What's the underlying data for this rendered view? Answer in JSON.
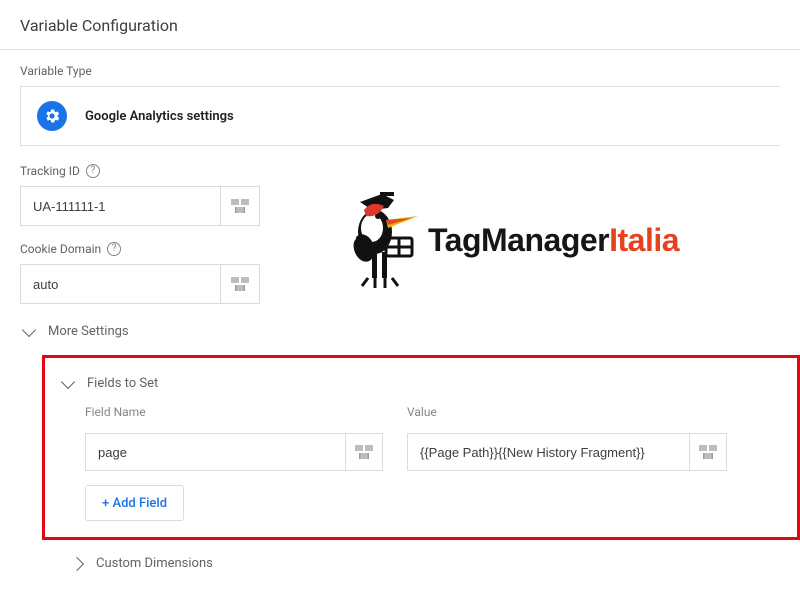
{
  "header": {
    "title": "Variable Configuration"
  },
  "variable_type": {
    "label": "Variable Type",
    "selected": "Google Analytics settings"
  },
  "tracking_id": {
    "label": "Tracking ID",
    "value": "UA-111111-1"
  },
  "cookie_domain": {
    "label": "Cookie Domain",
    "value": "auto"
  },
  "more_settings": {
    "label": "More Settings",
    "fields_to_set": {
      "label": "Fields to Set",
      "columns": {
        "name": "Field Name",
        "value": "Value"
      },
      "rows": [
        {
          "name": "page",
          "value": "{{Page Path}}{{New History Fragment}}"
        }
      ],
      "add_label": "+ Add Field"
    },
    "custom_dimensions": {
      "label": "Custom Dimensions"
    }
  },
  "watermark": {
    "brand1": "TagManager",
    "brand2": "Italia"
  }
}
